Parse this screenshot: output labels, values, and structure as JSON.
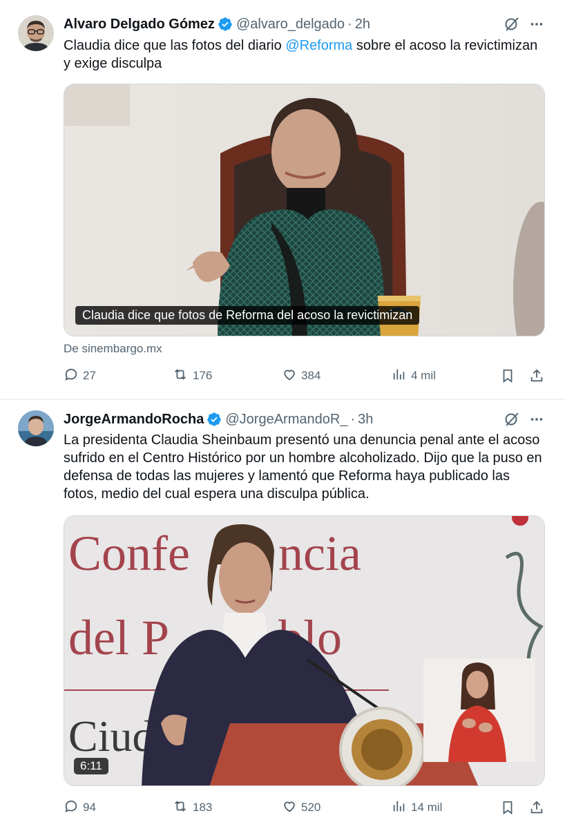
{
  "tweets": [
    {
      "name": "Alvaro Delgado Gómez",
      "handle": "@alvaro_delgado",
      "separator": "·",
      "time": "2h",
      "text_before": "Claudia dice que las fotos del diario ",
      "mention": "@Reforma",
      "text_after": " sobre el acoso la revictimizan y exige disculpa",
      "media_caption": "Claudia dice que fotos de Reforma del acoso la revictimizan",
      "source": "De sinembargo.mx",
      "replies": "27",
      "retweets": "176",
      "likes": "384",
      "views": "4 mil"
    },
    {
      "name": "JorgeArmandoRocha",
      "handle": "@JorgeArmandoR_",
      "separator": "·",
      "time": "3h",
      "text": "La presidenta Claudia Sheinbaum presentó una denuncia penal ante el acoso sufrido en el Centro Histórico por un hombre alcoholizado. Dijo que la puso en defensa de todas las mujeres y lamentó que Reforma haya publicado las fotos, medio del cual espera una disculpa pública.",
      "video_backdrop_text": [
        "Confe",
        "ncia",
        "del P",
        "blo",
        "Ciud"
      ],
      "video_duration": "6:11",
      "replies": "94",
      "retweets": "183",
      "likes": "520",
      "views": "14 mil"
    }
  ],
  "icons": {
    "verified": "verified-badge-icon",
    "grok": "grok-icon",
    "more": "more-icon",
    "reply": "reply-icon",
    "retweet": "retweet-icon",
    "like": "like-icon",
    "views": "views-icon",
    "bookmark": "bookmark-icon",
    "share": "share-icon"
  },
  "colors": {
    "accent": "#1d9bf0",
    "text": "#0f1419",
    "secondary": "#536471"
  }
}
